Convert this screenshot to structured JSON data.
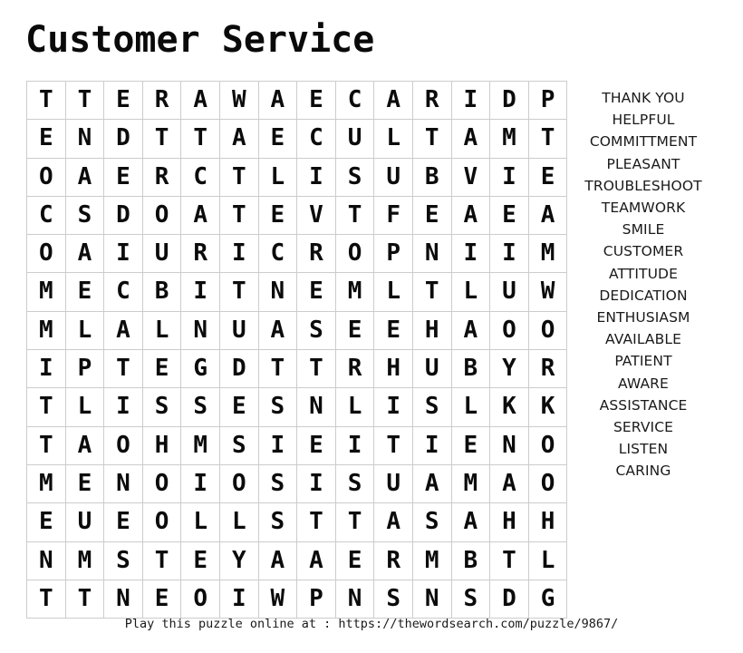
{
  "page": {
    "title": "Customer Service",
    "background_color": "#ffffff",
    "text_color": "#0b0b0b",
    "grid_border_color": "#cccccc"
  },
  "grid": {
    "rows": 14,
    "cols": 14,
    "letters": [
      [
        "T",
        "T",
        "E",
        "R",
        "A",
        "W",
        "A",
        "E",
        "C",
        "A",
        "R",
        "I",
        "D",
        "P"
      ],
      [
        "E",
        "N",
        "D",
        "T",
        "T",
        "A",
        "E",
        "C",
        "U",
        "L",
        "T",
        "A",
        "M",
        "T"
      ],
      [
        "O",
        "A",
        "E",
        "R",
        "C",
        "T",
        "L",
        "I",
        "S",
        "U",
        "B",
        "V",
        "I",
        "E"
      ],
      [
        "C",
        "S",
        "D",
        "O",
        "A",
        "T",
        "E",
        "V",
        "T",
        "F",
        "E",
        "A",
        "E",
        "A"
      ],
      [
        "O",
        "A",
        "I",
        "U",
        "R",
        "I",
        "C",
        "R",
        "O",
        "P",
        "N",
        "I",
        "I",
        "M"
      ],
      [
        "M",
        "E",
        "C",
        "B",
        "I",
        "T",
        "N",
        "E",
        "M",
        "L",
        "T",
        "L",
        "U",
        "W"
      ],
      [
        "M",
        "L",
        "A",
        "L",
        "N",
        "U",
        "A",
        "S",
        "E",
        "E",
        "H",
        "A",
        "O",
        "O"
      ],
      [
        "I",
        "P",
        "T",
        "E",
        "G",
        "D",
        "T",
        "T",
        "R",
        "H",
        "U",
        "B",
        "Y",
        "R"
      ],
      [
        "T",
        "L",
        "I",
        "S",
        "S",
        "E",
        "S",
        "N",
        "L",
        "I",
        "S",
        "L",
        "K",
        "K"
      ],
      [
        "T",
        "A",
        "O",
        "H",
        "M",
        "S",
        "I",
        "E",
        "I",
        "T",
        "I",
        "E",
        "N",
        "O"
      ],
      [
        "M",
        "E",
        "N",
        "O",
        "I",
        "O",
        "S",
        "I",
        "S",
        "U",
        "A",
        "M",
        "A",
        "O"
      ],
      [
        "E",
        "U",
        "E",
        "O",
        "L",
        "L",
        "S",
        "T",
        "T",
        "A",
        "S",
        "A",
        "H",
        "H"
      ],
      [
        "N",
        "M",
        "S",
        "T",
        "E",
        "Y",
        "A",
        "A",
        "E",
        "R",
        "M",
        "B",
        "T",
        "L"
      ],
      [
        "T",
        "T",
        "N",
        "E",
        "O",
        "I",
        "W",
        "P",
        "N",
        "S",
        "N",
        "S",
        "D",
        "G"
      ]
    ]
  },
  "word_list": {
    "words": [
      "THANK YOU",
      "HELPFUL",
      "COMMITTMENT",
      "PLEASANT",
      "TROUBLESHOOT",
      "TEAMWORK",
      "SMILE",
      "CUSTOMER",
      "ATTITUDE",
      "DEDICATION",
      "ENTHUSIASM",
      "AVAILABLE",
      "PATIENT",
      "AWARE",
      "ASSISTANCE",
      "SERVICE",
      "LISTEN",
      "CARING"
    ]
  },
  "footer": {
    "text": "Play this puzzle online at : https://thewordsearch.com/puzzle/9867/"
  }
}
